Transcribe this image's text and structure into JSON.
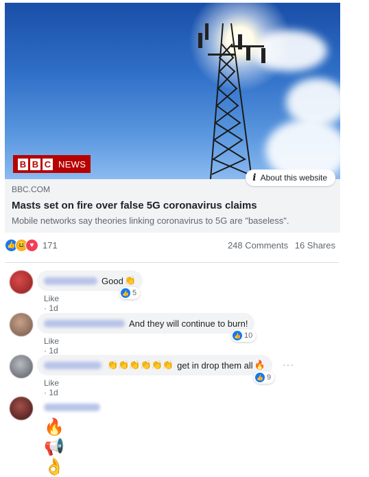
{
  "link_preview": {
    "source_logo": "BBC",
    "source_logo_letters": [
      "B",
      "B",
      "C"
    ],
    "source_logo_suffix": "NEWS",
    "about_label": "About this website",
    "domain": "BBC.COM",
    "title": "Masts set on fire over false 5G coronavirus claims",
    "description": "Mobile networks say theories linking coronavirus to 5G are \"baseless\"."
  },
  "stats": {
    "reaction_icons": [
      "like",
      "haha",
      "love"
    ],
    "reaction_count": "171",
    "comments": "248 Comments",
    "shares": "16 Shares"
  },
  "comments": [
    {
      "text": "Good",
      "emoji": "👏",
      "like_label": "Like",
      "time": "1d",
      "likes": "5",
      "avatar_color": "#c23b3b"
    },
    {
      "text": "And they will continue to burn!",
      "emoji": "",
      "like_label": "Like",
      "time": "1d",
      "likes": "10",
      "avatar_color": "#9a7b6a"
    },
    {
      "text": "get in drop them all",
      "prefix_emojis": "👏👏👏👏👏👏",
      "emoji": "🔥",
      "like_label": "Like",
      "time": "1d",
      "likes": "9",
      "more": "···",
      "avatar_color": "#7a7f86"
    },
    {
      "text": "",
      "emoji": "🔥📢👌",
      "avatar_color": "#6b2e2e"
    }
  ],
  "colors": {
    "accent": "#1877f2",
    "bbc_red": "#b80000",
    "bubble_bg": "#f2f3f5"
  }
}
